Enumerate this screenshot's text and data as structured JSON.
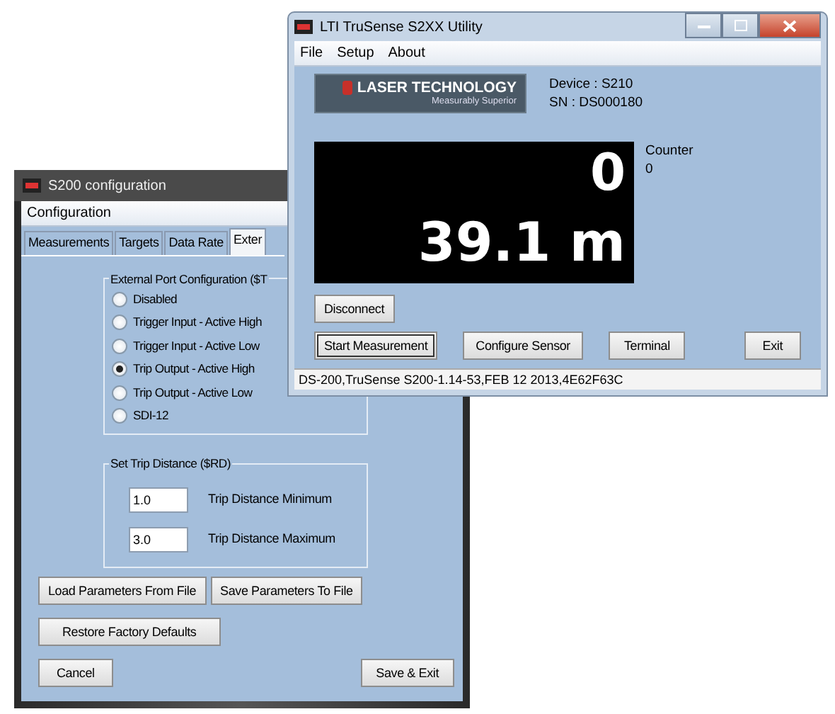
{
  "config_window": {
    "title": "S200 configuration",
    "menu": [
      "Configuration"
    ],
    "tabs": [
      {
        "label": "Measurements",
        "selected": false
      },
      {
        "label": "Targets",
        "selected": false
      },
      {
        "label": "Data Rate",
        "selected": false
      },
      {
        "label": "Exter",
        "selected": true
      }
    ],
    "port_group": {
      "title": "External Port Configuration  ($T",
      "options": [
        {
          "label": "Disabled",
          "selected": false
        },
        {
          "label": "Trigger Input - Active High",
          "selected": false
        },
        {
          "label": "Trigger Input - Active Low",
          "selected": false
        },
        {
          "label": "Trip Output - Active High",
          "selected": true
        },
        {
          "label": "Trip Output - Active Low",
          "selected": false
        },
        {
          "label": "SDI-12",
          "selected": false
        }
      ]
    },
    "trip_group": {
      "title": "Set Trip Distance ($RD)",
      "fields": [
        {
          "value": "1.0",
          "label": "Trip Distance Minimum"
        },
        {
          "value": "3.0",
          "label": "Trip Distance Maximum"
        }
      ]
    },
    "button_rows": [
      [
        "Load Parameters From File",
        "Save Parameters To File"
      ],
      [
        "Restore Factory Defaults"
      ],
      [
        "Cancel",
        "Save & Exit"
      ]
    ]
  },
  "utility_window": {
    "title": "LTI TruSense S2XX Utility",
    "menu": [
      "File",
      "Setup",
      "About"
    ],
    "logo": {
      "name": "LASER TECHNOLOGY",
      "tagline": "Measurably Superior"
    },
    "device": "Device :  S210",
    "sn": "SN :  DS000180",
    "display": {
      "count": "0",
      "distance": "39.1 m"
    },
    "counter": {
      "label": "Counter",
      "value": "0"
    },
    "top_buttons": [
      {
        "label": "Disconnect",
        "focused": false
      }
    ],
    "buttons": [
      {
        "label": "Start Measurement",
        "focused": true
      },
      {
        "label": "Configure Sensor",
        "focused": false
      },
      {
        "label": "Terminal",
        "focused": false
      },
      {
        "label": "Exit",
        "focused": false
      }
    ],
    "status_bar": "DS-200,TruSense S200-1.14-53,FEB 12 2013,4E62F63C"
  }
}
